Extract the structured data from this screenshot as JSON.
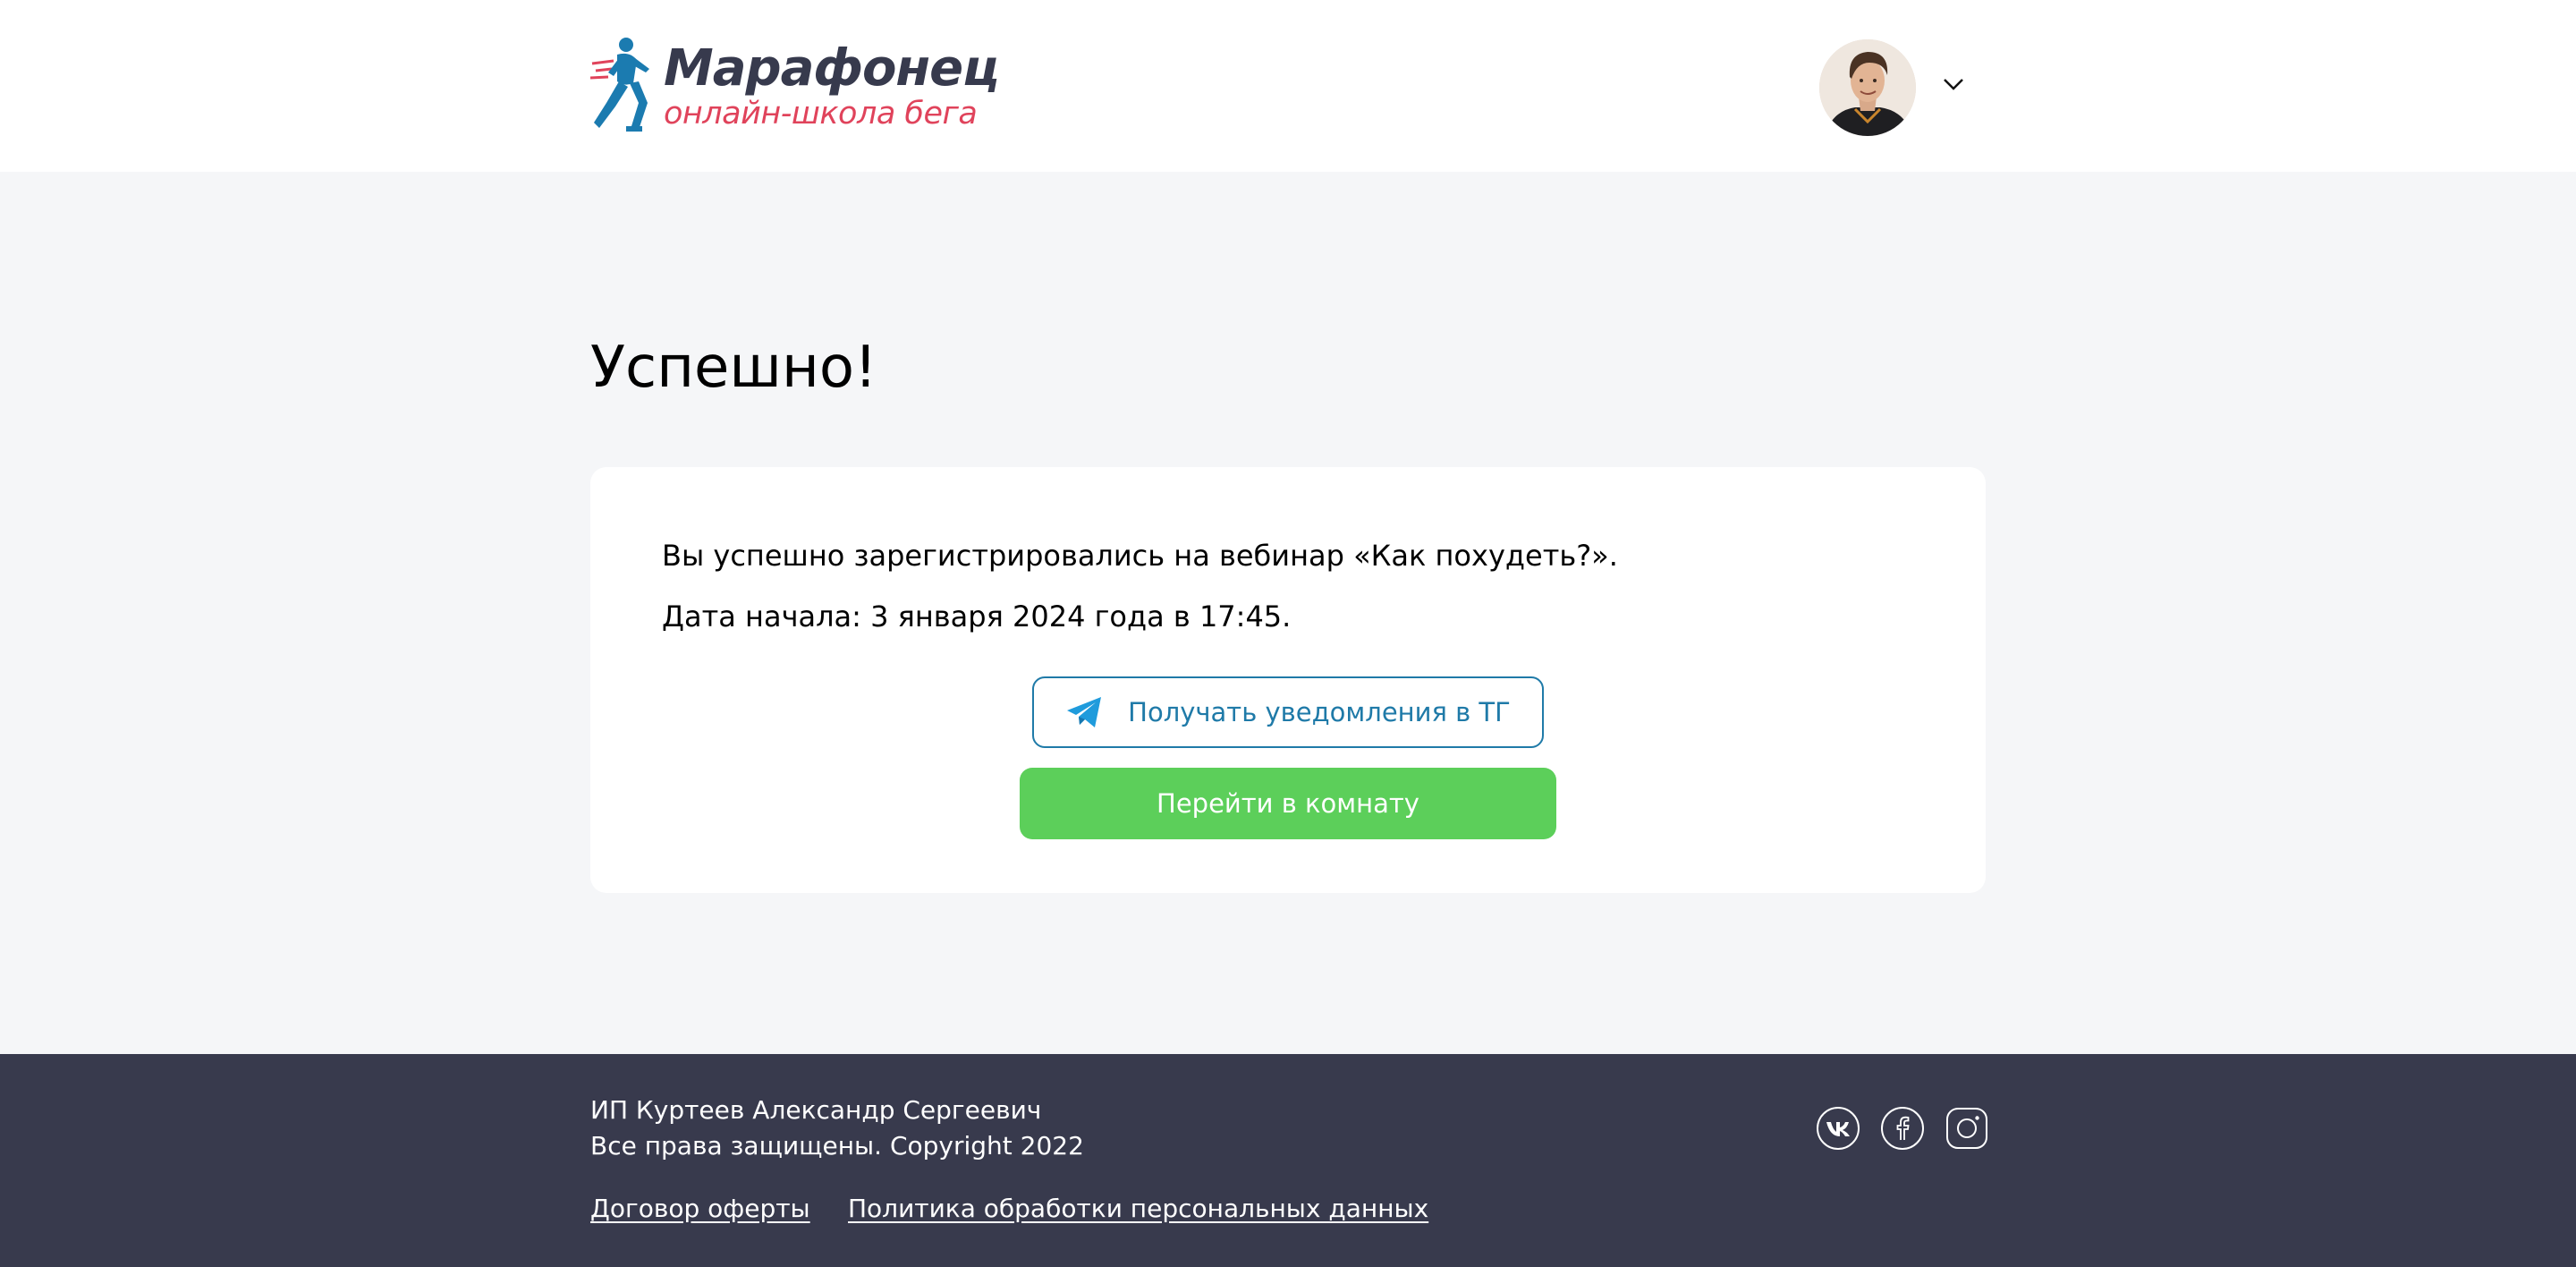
{
  "header": {
    "logo": {
      "title": "Марафонец",
      "subtitle": "онлайн-школа бега"
    },
    "user_menu": {
      "avatar_icon": "user-avatar",
      "chevron_icon": "chevron-down-icon"
    }
  },
  "main": {
    "title": "Успешно!",
    "card": {
      "message": "Вы успешно зарегистрировались на вебинар «Как похудеть?».",
      "start_date": "Дата начала: 3 января 2024 года в 17:45.",
      "telegram_button": {
        "label": "Получать уведомления в ТГ",
        "icon": "telegram-icon"
      },
      "room_button": {
        "label": "Перейти в комнату"
      }
    }
  },
  "footer": {
    "owner": "ИП Куртеев Александр Сергеевич",
    "copyright": "Все права защищены. Copyright 2022",
    "links": {
      "offer": "Договор оферты",
      "privacy": "Политика обработки персональных данных"
    },
    "social": [
      "vk-icon",
      "facebook-icon",
      "instagram-icon"
    ]
  },
  "colors": {
    "page_background": "#f5f6f8",
    "header_background": "#ffffff",
    "footer_background": "#383a4d",
    "brand_dark": "#373a4d",
    "brand_pink": "#e0435b",
    "telegram_blue": "#1f7aa8",
    "success_green": "#5ccf5a"
  }
}
